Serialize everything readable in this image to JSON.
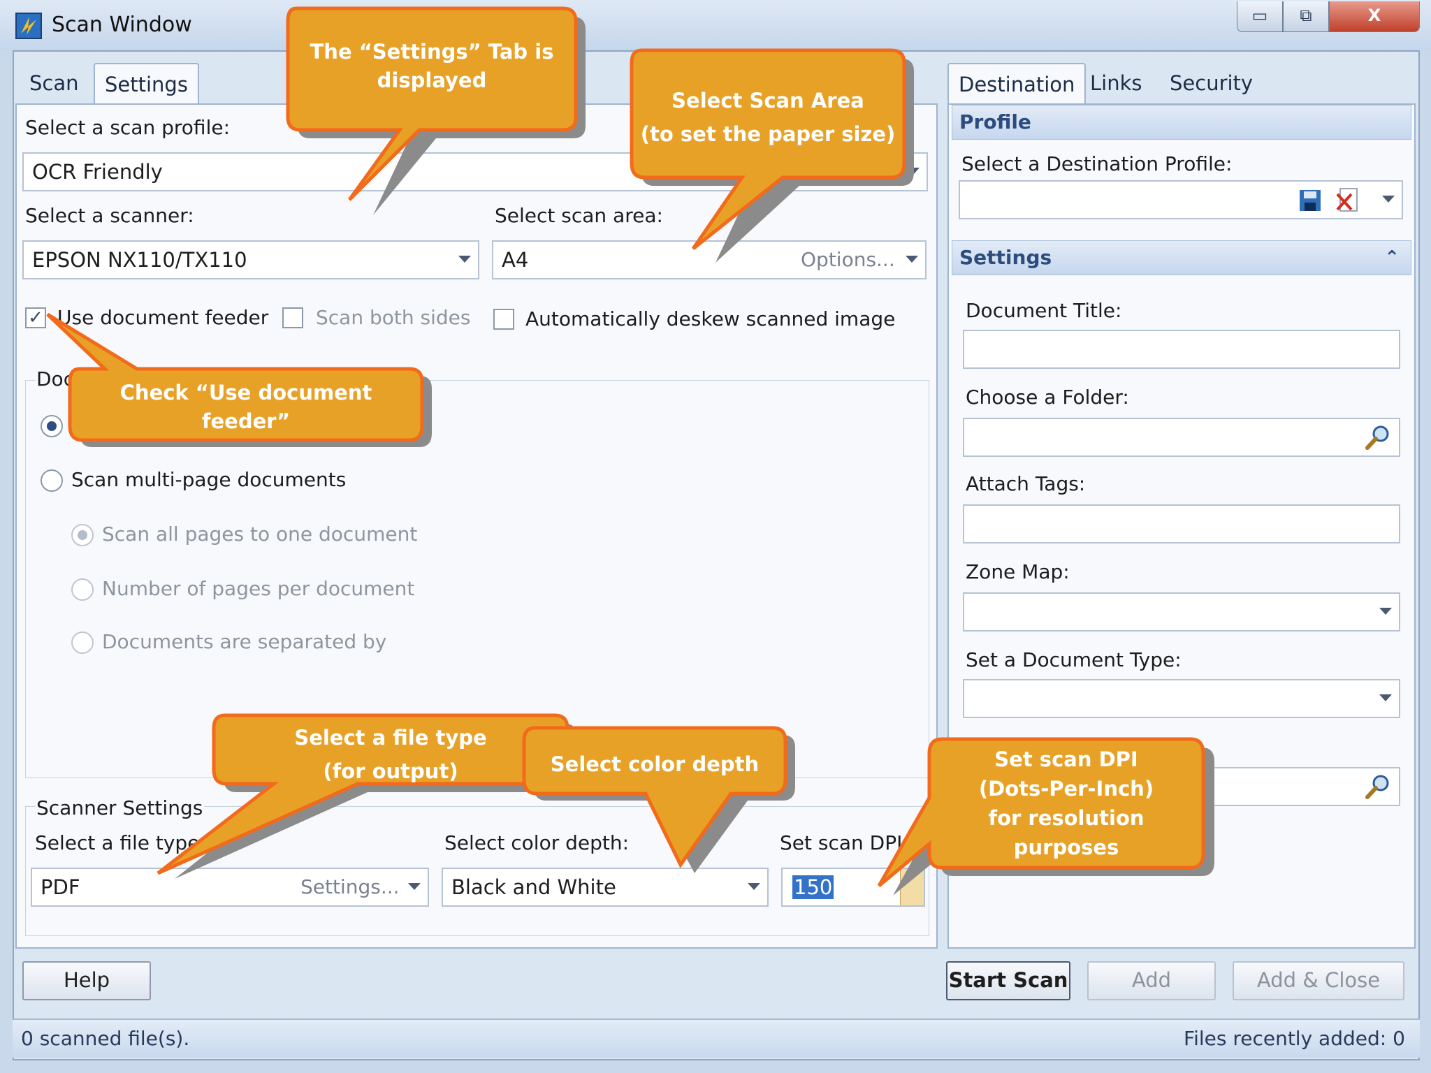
{
  "window": {
    "title": "Scan Window",
    "controls": {
      "minimize": "▭",
      "maximize": "⧉",
      "close": "X"
    }
  },
  "left_tabs": [
    "Scan",
    "Settings"
  ],
  "right_tabs": [
    "Destination",
    "Links",
    "Security"
  ],
  "settings": {
    "profile_label": "Select a scan profile:",
    "profile_value": "OCR Friendly",
    "scanner_label": "Select a scanner:",
    "scanner_value": "EPSON NX110/TX110",
    "area_label": "Select scan area:",
    "area_value": "A4",
    "area_options": "Options...",
    "use_feeder": "Use document feeder",
    "use_feeder_checked": true,
    "both_sides": "Scan both sides",
    "deskew": "Automatically deskew scanned image",
    "doc_group_label": "Doc",
    "multi_page": "Scan multi-page documents",
    "all_pages": "Scan all pages to one document",
    "pages_per_doc": "Number of pages per document",
    "separated_by": "Documents are separated by",
    "scanner_settings_label": "Scanner Settings",
    "file_type_label": "Select a file type:",
    "file_type_value": "PDF",
    "file_type_settings": "Settings...",
    "color_depth_label": "Select color depth:",
    "color_depth_value": "Black and White",
    "dpi_label": "Set scan DPI:",
    "dpi_value": "150"
  },
  "destination": {
    "profile_header": "Profile",
    "dest_profile_label": "Select a Destination Profile:",
    "settings_header": "Settings",
    "doc_title_label": "Document Title:",
    "folder_label": "Choose a Folder:",
    "tags_label": "Attach Tags:",
    "zone_map_label": "Zone Map:",
    "doc_type_label": "Set a Document Type:"
  },
  "buttons": {
    "help": "Help",
    "start_scan": "Start Scan",
    "add": "Add",
    "add_close": "Add & Close"
  },
  "status": {
    "left": "0 scanned file(s).",
    "right": "Files recently added: 0"
  },
  "callouts": {
    "settings_tab": "The “Settings” Tab is\ndisplayed",
    "scan_area": "Select Scan Area\n(to set the paper size)",
    "feeder": "Check “Use document\nfeeder”",
    "file_type": "Select a file type\n(for output)",
    "color_depth": "Select color depth",
    "dpi": "Set scan DPI\n(Dots-Per-Inch)\nfor resolution\npurposes"
  },
  "colors": {
    "callout_fill": "#e8a127",
    "callout_border": "#f26a1b",
    "callout_shadow": "#8b8b8b",
    "panel_bg": "#f7f9fc",
    "accent": "#2c4c7d"
  }
}
